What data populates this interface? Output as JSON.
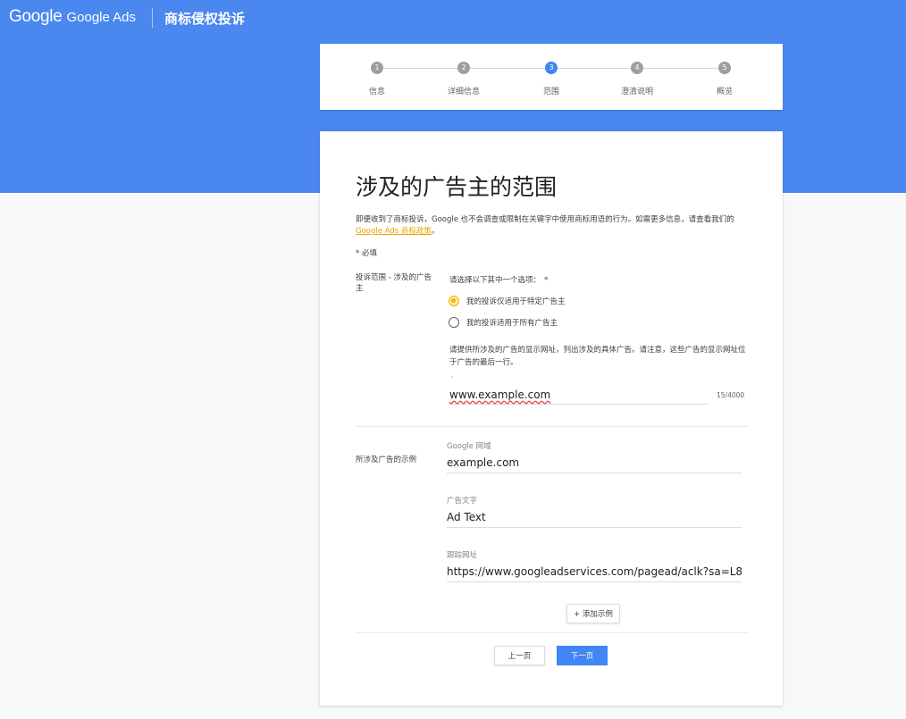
{
  "header": {
    "logo_google": "Google",
    "logo_ads": "Google Ads",
    "title": "商标侵权投诉"
  },
  "stepper": {
    "steps": [
      {
        "number": "1",
        "label": "信息"
      },
      {
        "number": "2",
        "label": "详细信息"
      },
      {
        "number": "3",
        "label": "范围"
      },
      {
        "number": "4",
        "label": "澄清说明"
      },
      {
        "number": "5",
        "label": "概览"
      }
    ],
    "active_index": 2
  },
  "form": {
    "title": "涉及的广告主的范围",
    "intro_text": "即便收到了商标投诉，Google 也不会调查或限制在关键字中使用商标用语的行为。如需更多信息，请查看我们的",
    "intro_link": "Google Ads 商标政策",
    "intro_end": "。",
    "required_note": "* 必填",
    "scope_section_label": "投诉范围 - 涉及的广告主",
    "question": "请选择以下其中一个选项：",
    "question_star": "*",
    "options": [
      {
        "label": "我的投诉仅适用于特定广告主",
        "checked": true
      },
      {
        "label": "我的投诉适用于所有广告主",
        "checked": false
      }
    ],
    "url_description": "请提供所涉及的广告的显示网址，列出涉及的具体广告。请注意，这些广告的显示网址位于广告的最后一行。",
    "url_tick": ",",
    "url_value": "www.example.com",
    "url_counter": "15/4000",
    "examples_section_label": "所涉及广告的示例",
    "fields": [
      {
        "label": "Google 网域",
        "value": "example.com"
      },
      {
        "label": "广告文字",
        "value": "Ad Text"
      },
      {
        "label": "跟踪网址",
        "value": "https://www.googleadservices.com/pagead/aclk?sa=L8"
      }
    ],
    "add_example_label": "+ 添加示例",
    "prev_label": "上一页",
    "next_label": "下一页"
  }
}
